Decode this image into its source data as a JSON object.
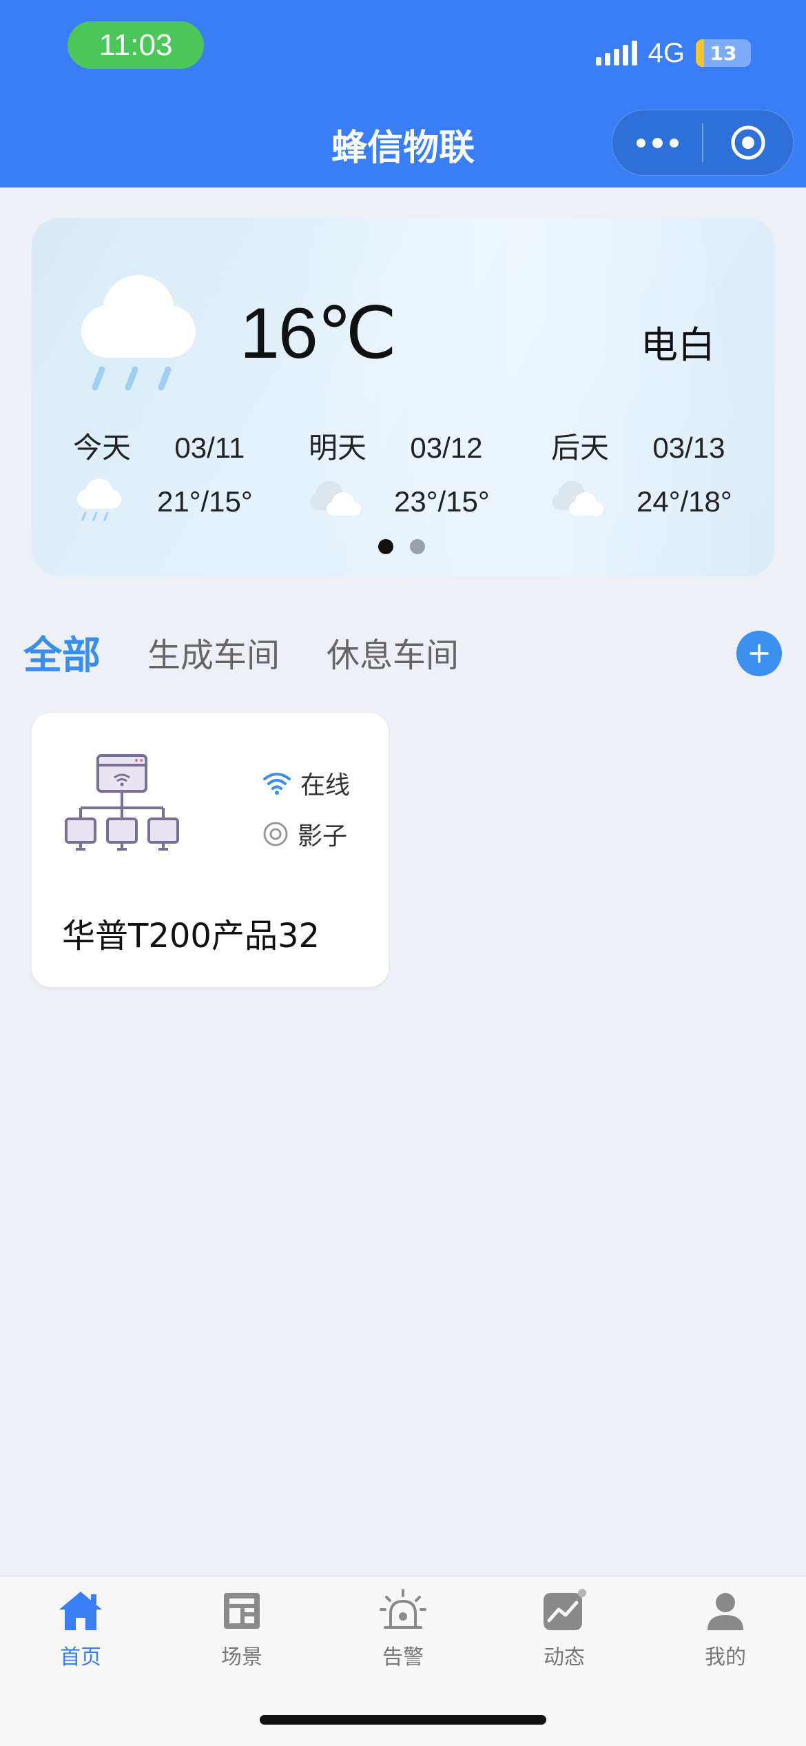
{
  "status_bar": {
    "time": "11:03",
    "network": "4G",
    "battery": "13"
  },
  "header": {
    "title": "蜂信物联"
  },
  "weather": {
    "temperature": "16℃",
    "location": "电白",
    "forecast": [
      {
        "day": "今天",
        "date": "03/11",
        "temps": "21°/15°",
        "icon": "rain-cloud"
      },
      {
        "day": "明天",
        "date": "03/12",
        "temps": "23°/15°",
        "icon": "cloudy"
      },
      {
        "day": "后天",
        "date": "03/13",
        "temps": "24°/18°",
        "icon": "cloudy"
      }
    ],
    "carousel": {
      "pages": 2,
      "current": 1
    }
  },
  "tabs": [
    {
      "label": "全部",
      "active": true
    },
    {
      "label": "生成车间",
      "active": false
    },
    {
      "label": "休息车间",
      "active": false
    }
  ],
  "device": {
    "name": "华普T200产品32",
    "status_online": "在线",
    "status_shadow": "影子"
  },
  "tabbar": [
    {
      "label": "首页",
      "icon": "home-icon",
      "active": true
    },
    {
      "label": "场景",
      "icon": "scene-icon",
      "active": false
    },
    {
      "label": "告警",
      "icon": "alarm-icon",
      "active": false
    },
    {
      "label": "动态",
      "icon": "trend-icon",
      "active": false
    },
    {
      "label": "我的",
      "icon": "user-icon",
      "active": false
    }
  ],
  "colors": {
    "primary": "#3a7ef6",
    "time_pill": "#4cc65a",
    "tab_active": "#3a8de8"
  }
}
